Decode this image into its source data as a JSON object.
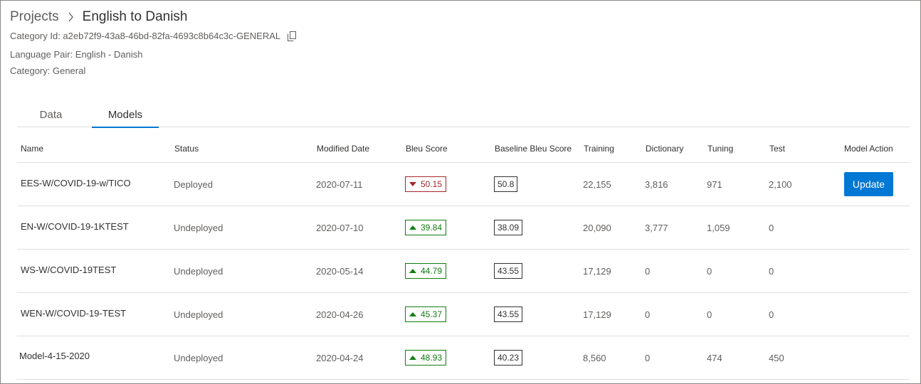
{
  "breadcrumb": {
    "root": "Projects",
    "current": "English to Danish"
  },
  "meta": {
    "category_id": "Category Id: a2eb72f9-43a8-46bd-82fa-4693c8b64c3c-GENERAL",
    "language_pair": "Language Pair: English - Danish",
    "category": "Category: General"
  },
  "tabs": {
    "data": "Data",
    "models": "Models",
    "selected": "Models"
  },
  "table": {
    "headers": {
      "name": "Name",
      "status": "Status",
      "modified": "Modified Date",
      "bleu": "Bleu Score",
      "baseline": "Baseline Bleu Score",
      "training": "Training",
      "dictionary": "Dictionary",
      "tuning": "Tuning",
      "test": "Test",
      "action": "Model Action"
    },
    "rows": [
      {
        "name": "EES-W/COVID-19-w/TICO",
        "status": "Deployed",
        "modified": "2020-07-11",
        "bleu": "50.15",
        "trend": "down",
        "baseline": "50.8",
        "training": "22,155",
        "dictionary": "3,816",
        "tuning": "971",
        "test": "2,100",
        "action": "Update"
      },
      {
        "name": "EN-W/COVID-19-1KTEST",
        "status": "Undeployed",
        "modified": "2020-07-10",
        "bleu": "39.84",
        "trend": "up",
        "baseline": "38.09",
        "training": "20,090",
        "dictionary": "3,777",
        "tuning": "1,059",
        "test": "0",
        "action": ""
      },
      {
        "name": "WS-W/COVID-19TEST",
        "status": "Undeployed",
        "modified": "2020-05-14",
        "bleu": "44.79",
        "trend": "up",
        "baseline": "43.55",
        "training": "17,129",
        "dictionary": "0",
        "tuning": "0",
        "test": "0",
        "action": ""
      },
      {
        "name": "WEN-W/COVID-19-TEST",
        "status": "Undeployed",
        "modified": "2020-04-26",
        "bleu": "45.37",
        "trend": "up",
        "baseline": "43.55",
        "training": "17,129",
        "dictionary": "0",
        "tuning": "0",
        "test": "0",
        "action": ""
      },
      {
        "name": "Model-4-15-2020",
        "status": "Undeployed",
        "modified": "2020-04-24",
        "bleu": "48.93",
        "trend": "up",
        "baseline": "40.23",
        "training": "8,560",
        "dictionary": "0",
        "tuning": "474",
        "test": "450",
        "action": ""
      }
    ]
  },
  "icons": {
    "separator": "chevron-right-icon",
    "copy": "copy-icon",
    "trend_up": "triangle-up-icon",
    "trend_down": "triangle-down-icon"
  },
  "colors": {
    "accent": "#0078d4",
    "positive": "#107c10",
    "negative": "#a4262c"
  }
}
